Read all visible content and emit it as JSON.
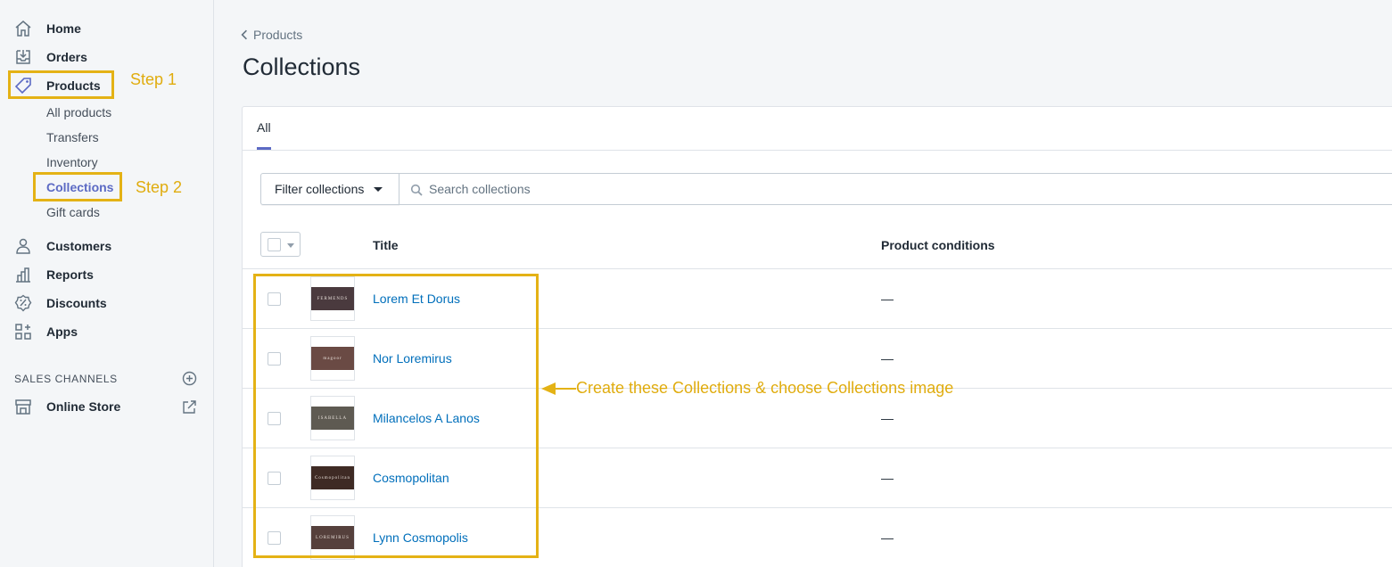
{
  "sidebar": {
    "nav": [
      {
        "label": "Home"
      },
      {
        "label": "Orders"
      },
      {
        "label": "Products"
      },
      {
        "label": "Customers"
      },
      {
        "label": "Reports"
      },
      {
        "label": "Discounts"
      },
      {
        "label": "Apps"
      }
    ],
    "products_sub": [
      {
        "label": "All products"
      },
      {
        "label": "Transfers"
      },
      {
        "label": "Inventory"
      },
      {
        "label": "Collections"
      },
      {
        "label": "Gift cards"
      }
    ],
    "sales_channels_heading": "SALES CHANNELS",
    "online_store": "Online Store"
  },
  "annotations": {
    "step1": "Step 1",
    "step2": "Step 2",
    "collections_note": "Create these Collections & choose Collections image",
    "color": "#e4b215"
  },
  "main": {
    "breadcrumb": "Products",
    "title": "Collections",
    "tab_all": "All",
    "filter_label": "Filter collections",
    "search_placeholder": "Search collections",
    "columns": {
      "title": "Title",
      "conditions": "Product conditions"
    },
    "rows": [
      {
        "title": "Lorem Et Dorus",
        "conditions": "—",
        "thumb_text": "FERMENDS",
        "thumb_color": "#4a3a3e"
      },
      {
        "title": "Nor Loremirus",
        "conditions": "—",
        "thumb_text": "magoor",
        "thumb_color": "#6a4a44"
      },
      {
        "title": "Milancelos A Lanos",
        "conditions": "—",
        "thumb_text": "ISABELLA",
        "thumb_color": "#5e5a52"
      },
      {
        "title": "Cosmopolitan",
        "conditions": "—",
        "thumb_text": "Cosmopolitan",
        "thumb_color": "#3e2a24"
      },
      {
        "title": "Lynn Cosmopolis",
        "conditions": "—",
        "thumb_text": "LOREMIRUS",
        "thumb_color": "#55403c"
      }
    ]
  },
  "colors": {
    "accent": "#5c6ac4",
    "link": "#006fbb"
  }
}
